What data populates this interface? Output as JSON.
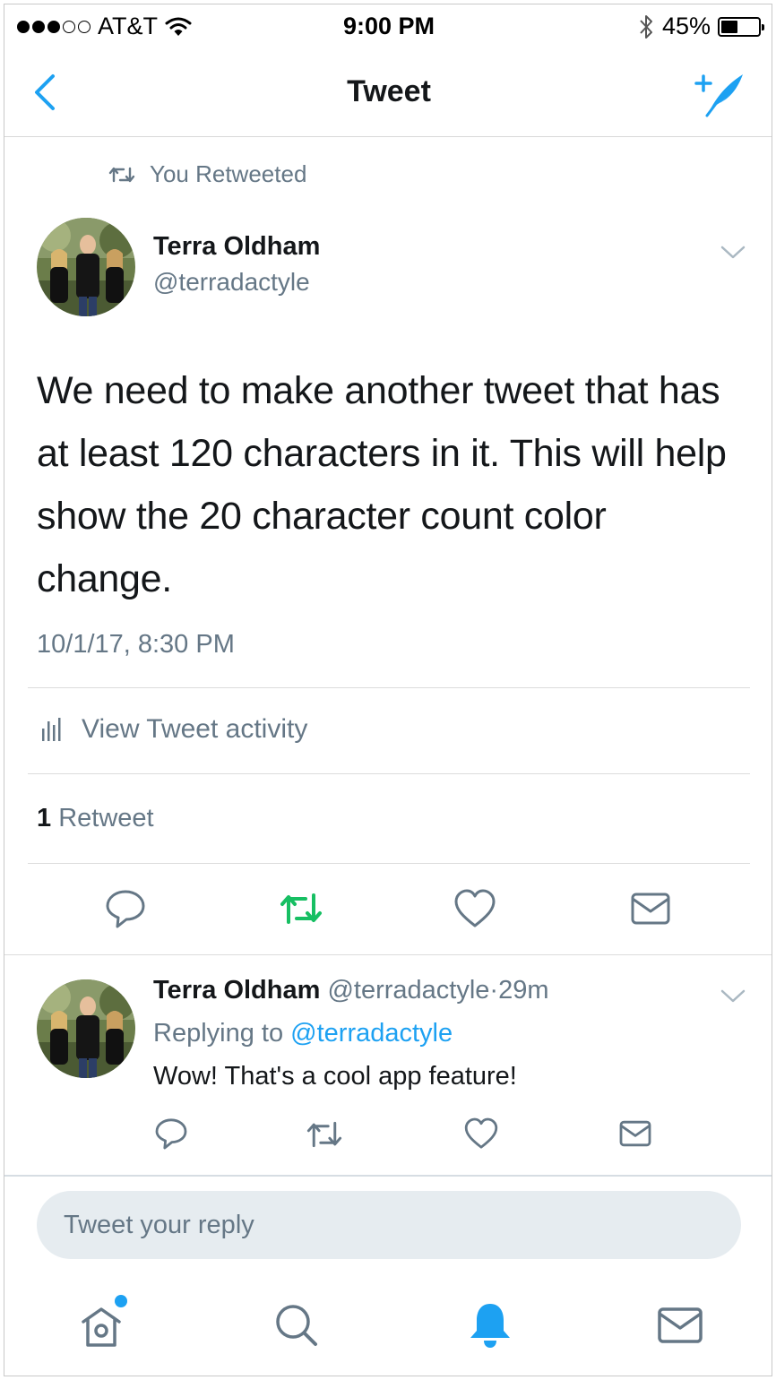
{
  "status_bar": {
    "carrier": "AT&T",
    "time": "9:00 PM",
    "battery": "45%",
    "battery_level": 0.45,
    "signal_bars_filled": 3,
    "signal_bars_total": 5
  },
  "nav": {
    "title": "Tweet",
    "back_icon": "chevron-left-icon",
    "compose_icon": "compose-feather-icon"
  },
  "tweet": {
    "retweeted_label": "You Retweeted",
    "author_name": "Terra Oldham",
    "author_handle": "@terradactyle",
    "text": "We need to make another tweet that has at least 120 characters in it. This will help show the 20 character count color change.",
    "timestamp": "10/1/17, 8:30 PM",
    "activity_label": "View Tweet activity",
    "retweet_count": "1",
    "retweet_label": "Retweet",
    "retweet_active_color": "#17bf63"
  },
  "reply": {
    "author_name": "Terra Oldham",
    "author_handle": "@terradactyle",
    "separator": "·",
    "age": "29m",
    "replying_prefix": "Replying to",
    "replying_handle": "@terradactyle",
    "text": "Wow! That's a cool app feature!"
  },
  "composer": {
    "placeholder": "Tweet your reply"
  },
  "tab_bar": {
    "items": [
      "home-icon",
      "search-icon",
      "notifications-bell-icon",
      "messages-envelope-icon"
    ],
    "active": "notifications-bell-icon"
  },
  "colors": {
    "accent": "#1da1f2",
    "secondary_text": "#657786",
    "primary_text": "#14171a"
  }
}
